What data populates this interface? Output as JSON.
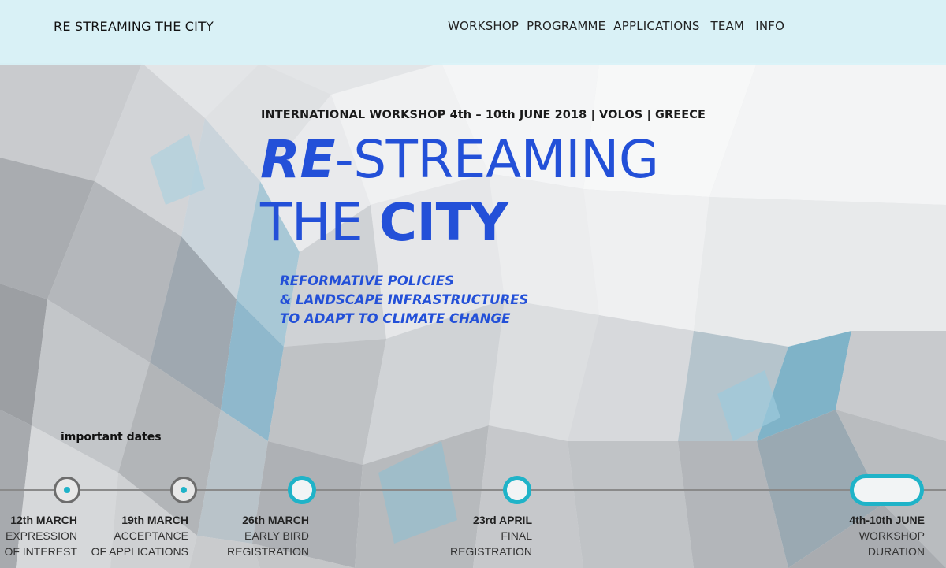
{
  "header": {
    "brand": "RE STREAMING THE CITY",
    "nav": [
      {
        "label": "WORKSHOP"
      },
      {
        "label": "PROGRAMME"
      },
      {
        "label": "APPLICATIONS"
      },
      {
        "label": "TEAM"
      },
      {
        "label": "INFO"
      }
    ]
  },
  "hero": {
    "event_line": "INTERNATIONAL WORKSHOP 4th – 10th JUNE 2018 | VOLOS | GREECE",
    "title_re": "RE",
    "title_streaming": "-STREAMING",
    "title_the": "THE ",
    "title_city": "CITY",
    "tagline": [
      "REFORMATIVE POLICIES",
      "& LANDSCAPE INFRASTRUCTURES",
      "TO ADAPT TO CLIMATE CHANGE"
    ]
  },
  "timeline": {
    "title": "important dates",
    "events": [
      {
        "date": "12th MARCH",
        "line1": "EXPRESSION",
        "line2": "OF INTEREST",
        "status": "past"
      },
      {
        "date": "19th MARCH",
        "line1": "ACCEPTANCE",
        "line2": "OF APPLICATIONS",
        "status": "past"
      },
      {
        "date": "26th MARCH",
        "line1": "EARLY BIRD",
        "line2": "REGISTRATION",
        "status": "upcoming"
      },
      {
        "date": "23rd APRIL",
        "line1": "FINAL",
        "line2": "REGISTRATION",
        "status": "upcoming"
      },
      {
        "date": "4th-10th JUNE",
        "line1": "WORKSHOP",
        "line2": "DURATION",
        "status": "event"
      }
    ]
  },
  "colors": {
    "accent_blue": "#2350d8",
    "accent_teal": "#1fb3c8",
    "header_bg": "#d8f2f7"
  }
}
